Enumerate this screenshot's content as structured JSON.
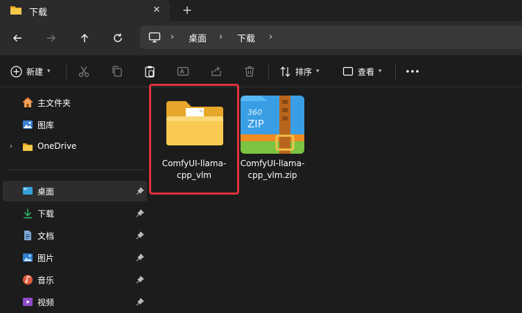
{
  "tab": {
    "title": "下载",
    "close_icon": "close-icon",
    "new_tab_icon": "plus-icon"
  },
  "nav": {
    "breadcrumbs": [
      "桌面",
      "下载"
    ]
  },
  "toolbar": {
    "new_label": "新建",
    "sort_label": "排序",
    "view_label": "查看"
  },
  "sidebar": {
    "items": [
      {
        "label": "主文件夹",
        "icon": "home-icon"
      },
      {
        "label": "图库",
        "icon": "gallery-icon"
      },
      {
        "label": "OneDrive",
        "icon": "folder-icon"
      },
      {
        "label": "桌面",
        "icon": "desktop-icon"
      },
      {
        "label": "下载",
        "icon": "download-icon"
      },
      {
        "label": "文档",
        "icon": "document-icon"
      },
      {
        "label": "图片",
        "icon": "picture-icon"
      },
      {
        "label": "音乐",
        "icon": "music-icon"
      },
      {
        "label": "视频",
        "icon": "video-icon"
      }
    ]
  },
  "files": [
    {
      "name_line1": "ComfyUI-llama-",
      "name_line2": "cpp_vlm",
      "type": "folder"
    },
    {
      "name_line1": "ComfyUI-llama-",
      "name_line2": "cpp_vlm.zip",
      "type": "zip"
    }
  ],
  "zip_icon_text": {
    "top": "360",
    "bottom": "ZIP"
  },
  "colors": {
    "highlight": "#e0343a",
    "folder": "#f7c948",
    "background": "#1c1c1c"
  }
}
